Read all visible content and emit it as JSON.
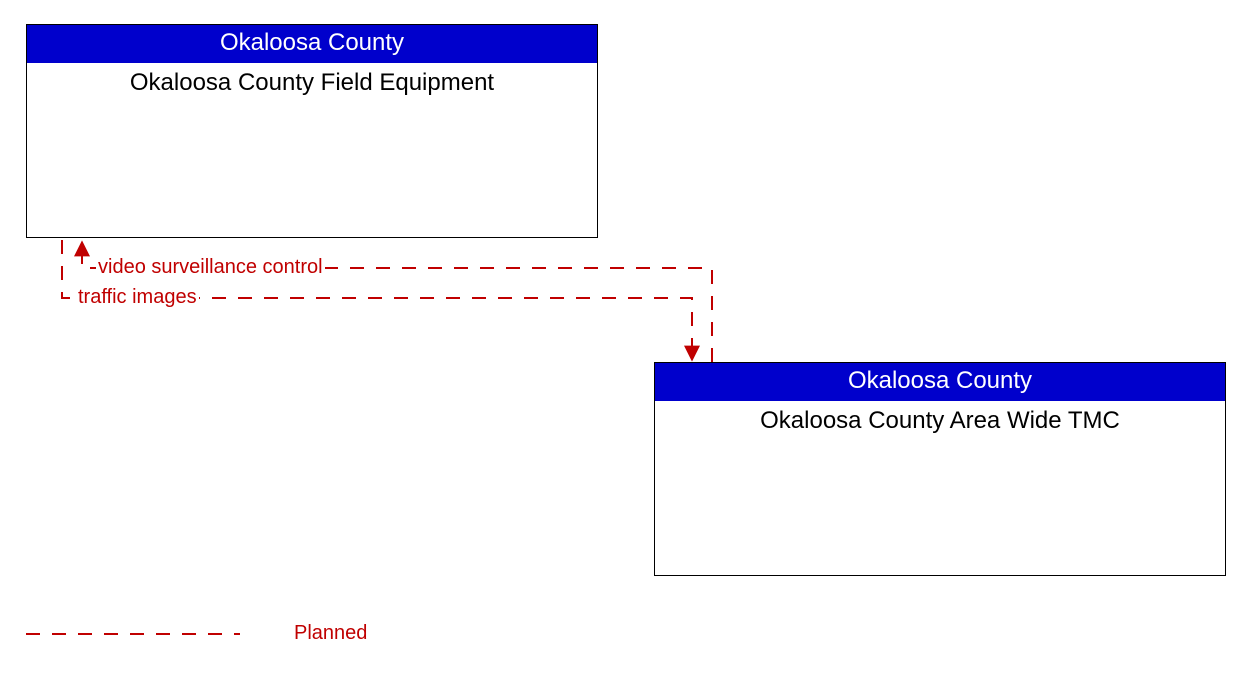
{
  "boxes": {
    "top": {
      "header": "Okaloosa County",
      "title": "Okaloosa County Field Equipment"
    },
    "bottom": {
      "header": "Okaloosa County",
      "title": "Okaloosa County Area Wide TMC"
    }
  },
  "flows": {
    "to_top": "video surveillance control",
    "to_bottom": "traffic images"
  },
  "legend": {
    "planned": "Planned"
  },
  "colors": {
    "header_bg": "#0000cc",
    "flow": "#c00000"
  }
}
